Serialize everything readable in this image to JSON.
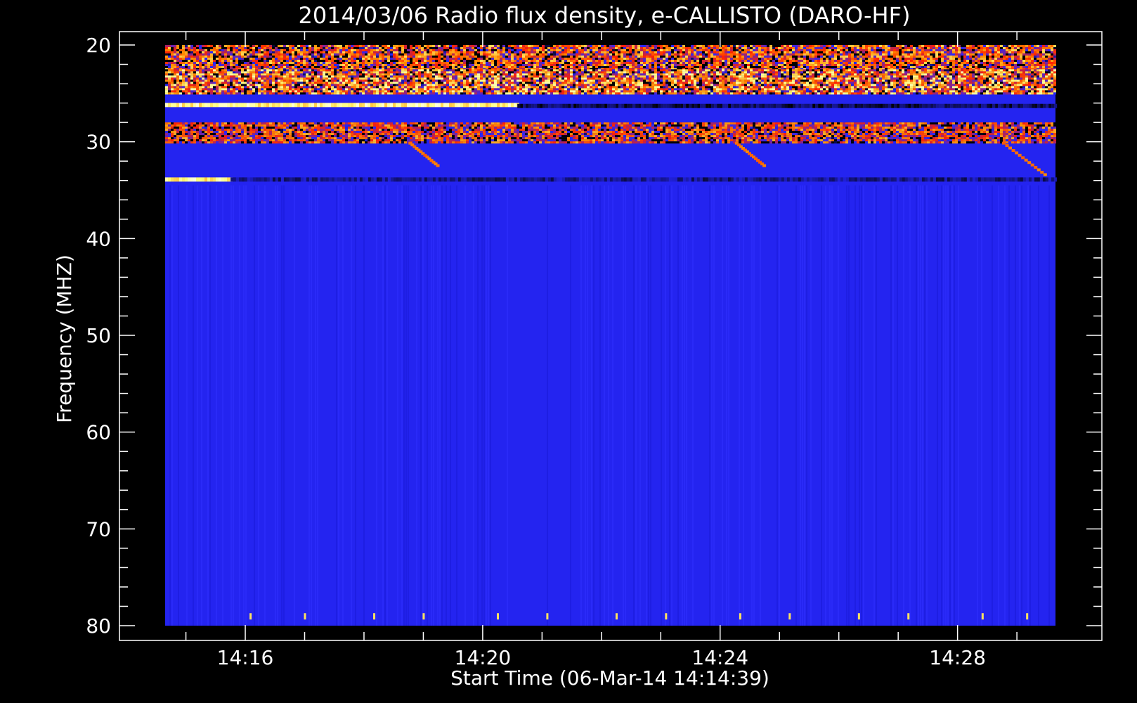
{
  "chart_data": {
    "type": "heatmap",
    "title": "2014/03/06  Radio flux density, e-CALLISTO (DARO-HF)",
    "xlabel": "Start Time (06-Mar-14 14:14:39)",
    "ylabel": "Frequency (MHZ)",
    "x_tick_labels": [
      "14:16",
      "14:20",
      "14:24",
      "14:28"
    ],
    "x_tick_minutes": [
      16,
      20,
      24,
      28
    ],
    "y_ticks": [
      20,
      30,
      40,
      50,
      60,
      70,
      80
    ],
    "y_range_mhz": [
      20,
      80
    ],
    "time_range": [
      "14:14:39",
      "14:29:39"
    ],
    "colormap": [
      "#000000",
      "#2626ff",
      "#ff2000",
      "#ff8c00",
      "#ffff80",
      "#ffffff"
    ],
    "background_color": "#2424f0",
    "features": [
      {
        "kind": "interference_band",
        "freq_mhz": [
          20,
          22.5
        ],
        "time": [
          "14:14:39",
          "14:29:39"
        ],
        "intensity": 0.55
      },
      {
        "kind": "interference_band",
        "freq_mhz": [
          22.5,
          25
        ],
        "time": [
          "14:14:39",
          "14:29:39"
        ],
        "intensity": 0.65
      },
      {
        "kind": "bright_line",
        "freq_mhz": 26.2,
        "time": [
          "14:14:39",
          "14:20:35"
        ],
        "intensity": 0.95
      },
      {
        "kind": "dark_line",
        "freq_mhz": 26.3,
        "time": [
          "14:20:35",
          "14:29:39"
        ],
        "intensity": 0.0
      },
      {
        "kind": "interference_band",
        "freq_mhz": [
          28,
          30
        ],
        "time": [
          "14:14:39",
          "14:29:39"
        ],
        "intensity": 0.5
      },
      {
        "kind": "bright_line",
        "freq_mhz": 33.9,
        "time": [
          "14:14:39",
          "14:15:45"
        ],
        "intensity": 0.95
      },
      {
        "kind": "dark_line",
        "freq_mhz": 33.9,
        "time": [
          "14:15:45",
          "14:29:39"
        ],
        "intensity": 0.05
      },
      {
        "kind": "drift_burst",
        "freq_mhz": [
          30,
          32.5
        ],
        "time": [
          "14:18:45",
          "14:19:15"
        ],
        "intensity": 0.6
      },
      {
        "kind": "drift_burst",
        "freq_mhz": [
          30,
          32.5
        ],
        "time": [
          "14:24:15",
          "14:24:45"
        ],
        "intensity": 0.6
      },
      {
        "kind": "drift_burst",
        "freq_mhz": [
          30,
          33.5
        ],
        "time": [
          "14:28:45",
          "14:29:30"
        ],
        "intensity": 0.6
      }
    ],
    "periodic_spikes_mhz": 79,
    "periodic_spike_times": [
      "14:16:05",
      "14:17:00",
      "14:18:10",
      "14:19:00",
      "14:20:15",
      "14:21:05",
      "14:22:15",
      "14:23:05",
      "14:24:20",
      "14:25:10",
      "14:26:20",
      "14:27:10",
      "14:28:25",
      "14:29:10"
    ]
  }
}
